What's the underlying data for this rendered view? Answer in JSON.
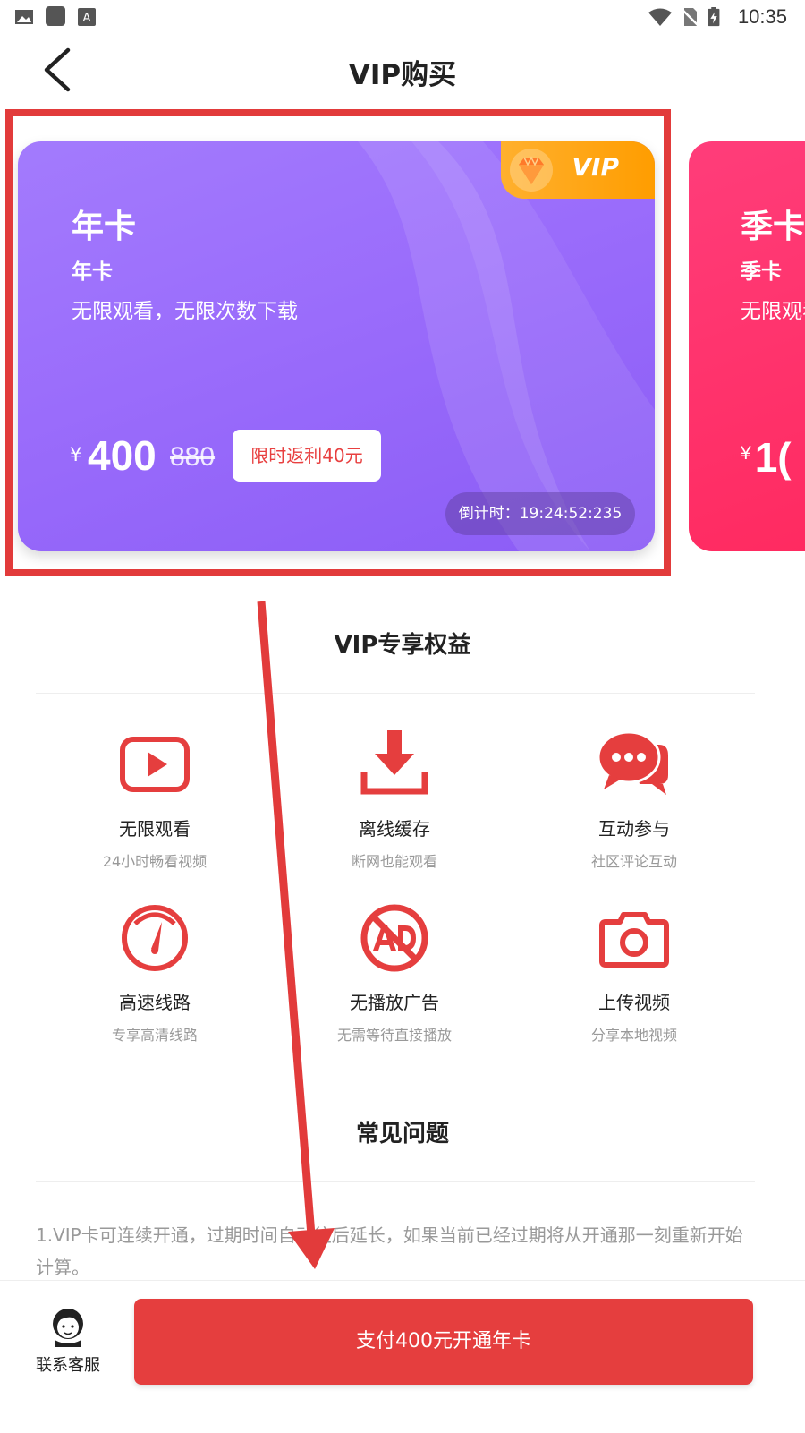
{
  "status_bar": {
    "time": "10:35"
  },
  "header": {
    "title": "VIP购买"
  },
  "plans": [
    {
      "title": "年卡",
      "subtitle": "年卡",
      "desc": "无限观看，无限次数下载",
      "badge": "VIP",
      "currency": "¥",
      "price": "400",
      "original_price": "880",
      "promo": "限时返利40元",
      "countdown": "倒计时：19:24:52:235"
    },
    {
      "title": "季卡",
      "subtitle": "季卡",
      "desc": "无限观看，无限次数下载",
      "currency": "¥",
      "price": "1("
    }
  ],
  "benefits": {
    "title": "VIP专享权益",
    "items": [
      {
        "icon": "play-icon",
        "name": "无限观看",
        "desc": "24小时畅看视频"
      },
      {
        "icon": "download-icon",
        "name": "离线缓存",
        "desc": "断网也能观看"
      },
      {
        "icon": "chat-icon",
        "name": "互动参与",
        "desc": "社区评论互动"
      },
      {
        "icon": "speedometer-icon",
        "name": "高速线路",
        "desc": "专享高清线路"
      },
      {
        "icon": "no-ad-icon",
        "name": "无播放广告",
        "desc": "无需等待直接播放"
      },
      {
        "icon": "camera-icon",
        "name": "上传视频",
        "desc": "分享本地视频"
      }
    ]
  },
  "faq": {
    "title": "常见问题",
    "item1": "1.VIP卡可连续开通，过期时间自动往后延长，如果当前已经过期将从开通那一刻重新开始计算。"
  },
  "bottom": {
    "support_label": "联系客服",
    "pay_label": "支付400元开通年卡"
  },
  "colors": {
    "accent": "#e53e3e",
    "card_purple": "#9a6cfb",
    "card_pink": "#ff2a60",
    "vip_badge": "#ffa514"
  }
}
